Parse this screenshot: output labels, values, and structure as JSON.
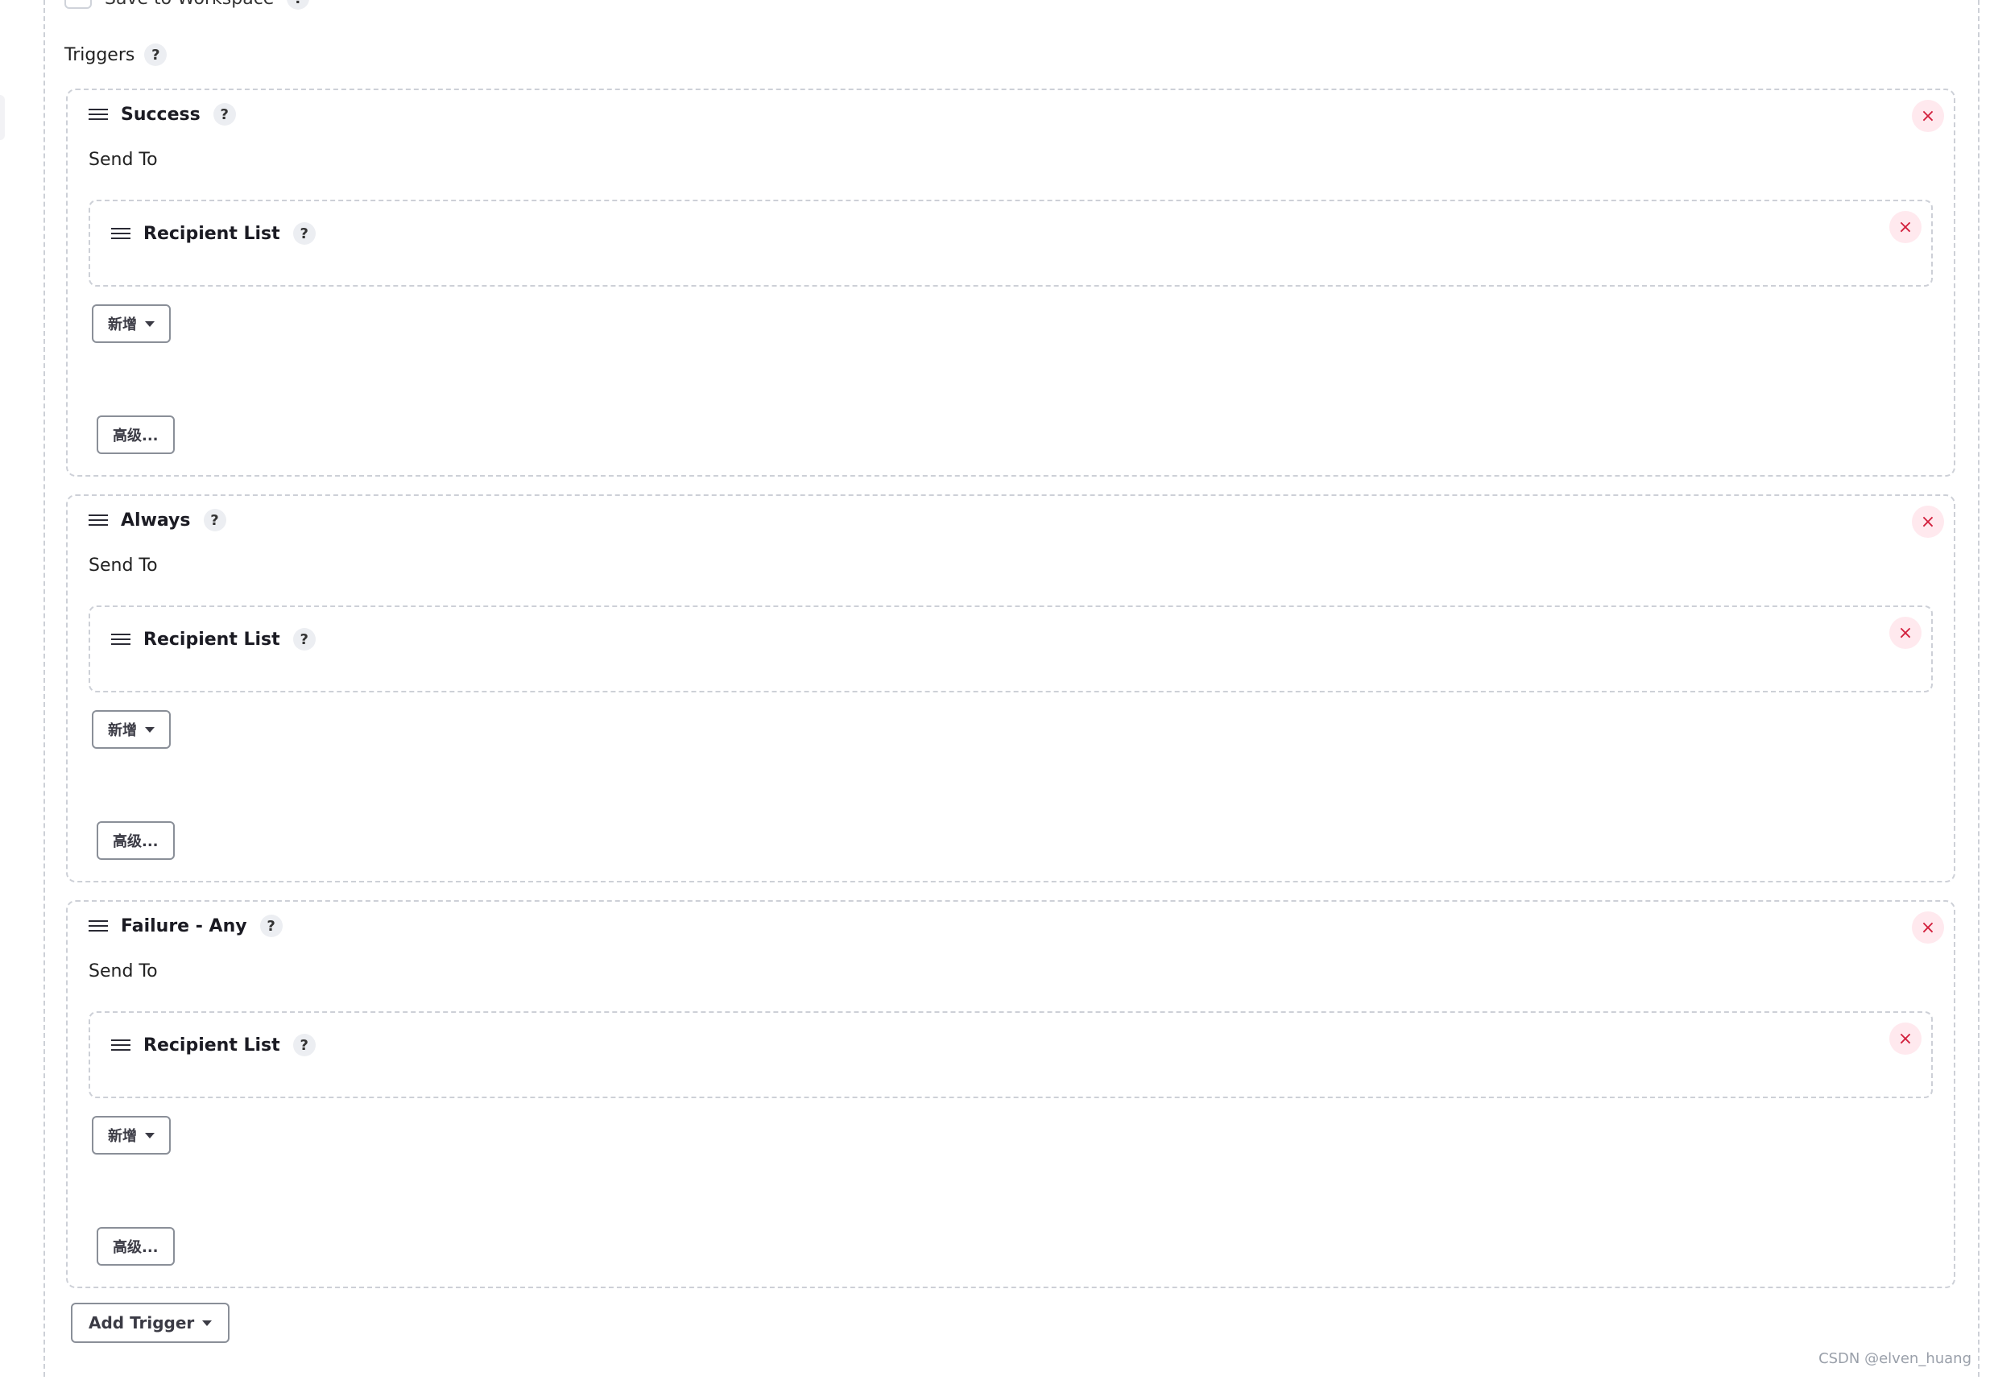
{
  "header": {
    "save_to_workspace": "Save to Workspace",
    "triggers_label": "Triggers",
    "help_symbol": "?"
  },
  "common": {
    "send_to_label": "Send To",
    "recipient_list_label": "Recipient List",
    "add_label": "新增",
    "advanced_label": "高级...",
    "close_symbol": "×"
  },
  "triggers": [
    {
      "name": "Success"
    },
    {
      "name": "Always"
    },
    {
      "name": "Failure - Any"
    }
  ],
  "footer": {
    "add_trigger_label": "Add Trigger",
    "watermark": "CSDN @elven_huang"
  },
  "icons": {
    "drag": "drag-handle-icon",
    "help": "help-icon",
    "close": "close-icon",
    "caret": "caret-down-icon"
  },
  "colors": {
    "border_dashed": "#cdd0d7",
    "close_bg": "#ffe9ee",
    "close_fg": "#d21f3c",
    "button_border": "#8a8f98"
  }
}
